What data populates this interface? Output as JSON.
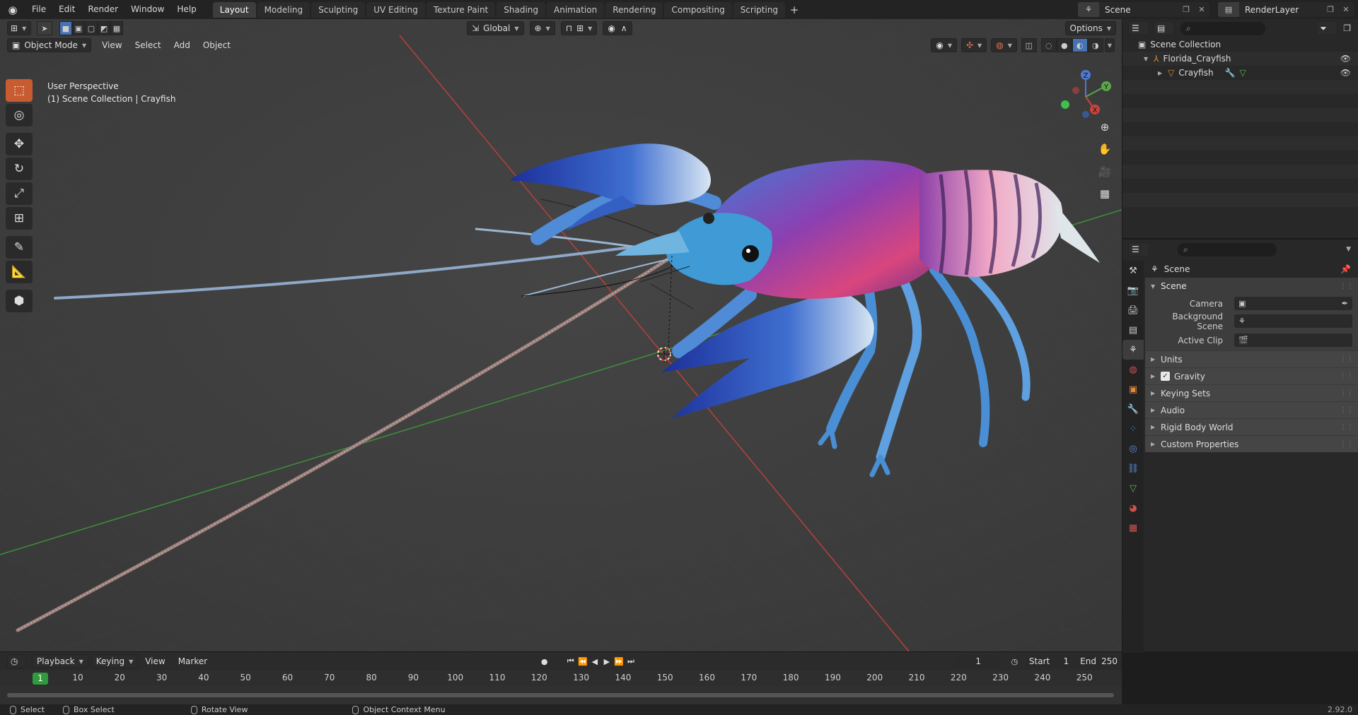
{
  "menubar": {
    "items": [
      "File",
      "Edit",
      "Render",
      "Window",
      "Help"
    ],
    "tabs": [
      "Layout",
      "Modeling",
      "Sculpting",
      "UV Editing",
      "Texture Paint",
      "Shading",
      "Animation",
      "Rendering",
      "Compositing",
      "Scripting"
    ],
    "add_tab": "+",
    "scene_name": "Scene",
    "view_layer": "RenderLayer"
  },
  "viewport": {
    "mode": "Object Mode",
    "menus": [
      "View",
      "Select",
      "Add",
      "Object"
    ],
    "orientation": "Global",
    "options_label": "Options",
    "overlay_line1": "User Perspective",
    "overlay_line2": "(1) Scene Collection | Crayfish",
    "gizmo_axes": {
      "z": "Z",
      "y": "Y",
      "x": "X"
    }
  },
  "outliner": {
    "root": "Scene Collection",
    "collection": "Florida_Crayfish",
    "object": "Crayfish"
  },
  "properties": {
    "context": "Scene",
    "panel_title": "Scene",
    "rows": [
      {
        "label": "Camera",
        "value": ""
      },
      {
        "label": "Background Scene",
        "value": ""
      },
      {
        "label": "Active Clip",
        "value": ""
      }
    ],
    "subpanels": [
      {
        "label": "Units",
        "checkbox": false
      },
      {
        "label": "Gravity",
        "checkbox": true
      },
      {
        "label": "Keying Sets",
        "checkbox": false
      },
      {
        "label": "Audio",
        "checkbox": false
      },
      {
        "label": "Rigid Body World",
        "checkbox": false
      },
      {
        "label": "Custom Properties",
        "checkbox": false
      }
    ]
  },
  "timeline": {
    "menus": [
      "Playback",
      "Keying",
      "View",
      "Marker"
    ],
    "current_frame": "1",
    "start_label": "Start",
    "start_value": "1",
    "end_label": "End",
    "end_value": "250",
    "ruler_labels": [
      "1",
      "10",
      "20",
      "30",
      "40",
      "50",
      "60",
      "70",
      "80",
      "90",
      "100",
      "110",
      "120",
      "130",
      "140",
      "150",
      "160",
      "170",
      "180",
      "190",
      "200",
      "210",
      "220",
      "230",
      "240",
      "250"
    ]
  },
  "statusbar": {
    "select": "Select",
    "box_select": "Box Select",
    "rotate_view": "Rotate View",
    "context_menu": "Object Context Menu",
    "version": "2.92.0"
  },
  "colors": {
    "accent_blue": "#4772b3",
    "active_tool": "#c85b2f",
    "current_frame": "#2f9a3e",
    "axis_x": "#b8403d",
    "axis_y": "#3f8f3a",
    "crayfish_body": "#7b3fa0",
    "crayfish_legs": "#4a8fd6"
  }
}
